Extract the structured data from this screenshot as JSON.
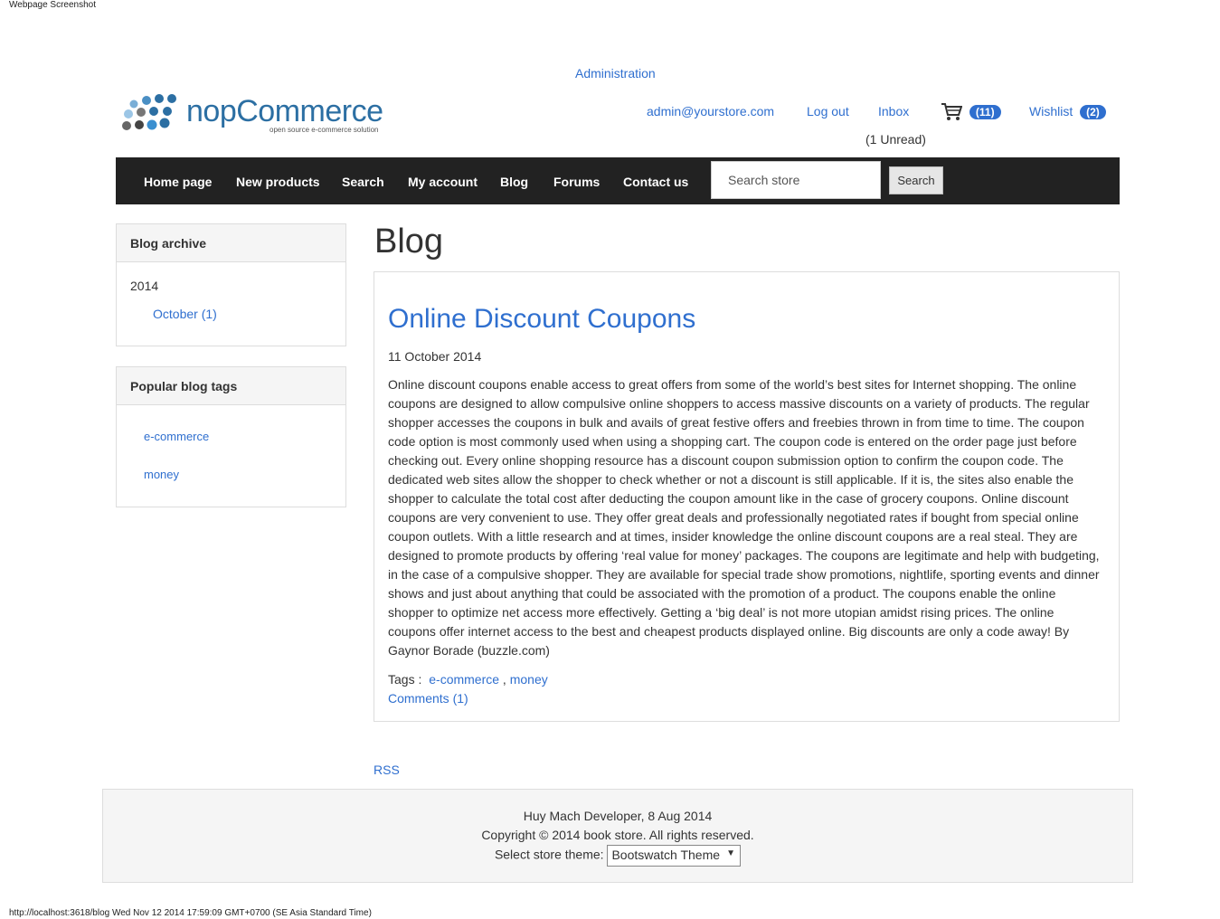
{
  "print": {
    "title": "Webpage Screenshot",
    "footer": "http://localhost:3618/blog Wed Nov 12 2014 17:59:09 GMT+0700 (SE Asia Standard Time)"
  },
  "header": {
    "admin_link": "Administration",
    "logo": {
      "name": "nopCommerce",
      "tagline": "open source e-commerce solution"
    },
    "account_email": "admin@yourstore.com",
    "logout": "Log out",
    "inbox": "Inbox",
    "unread": "(1 Unread)",
    "cart_count": "(11)",
    "wishlist": "Wishlist",
    "wishlist_count": "(2)"
  },
  "nav": {
    "items": [
      "Home page",
      "New products",
      "Search",
      "My account",
      "Blog",
      "Forums",
      "Contact us"
    ],
    "search_placeholder": "Search store",
    "search_button": "Search"
  },
  "sidebar": {
    "archive": {
      "title": "Blog archive",
      "year": "2014",
      "month": "October (1)"
    },
    "tags": {
      "title": "Popular blog tags",
      "items": [
        "e-commerce",
        "money"
      ]
    }
  },
  "main": {
    "page_title": "Blog",
    "post": {
      "title": "Online Discount Coupons",
      "date": "11 October 2014",
      "body": "Online discount coupons enable access to great offers from some of the world’s best sites for Internet shopping. The online coupons are designed to allow compulsive online shoppers to access massive discounts on a variety of products. The regular shopper accesses the coupons in bulk and avails of great festive offers and freebies thrown in from time to time. The coupon code option is most commonly used when using a shopping cart. The coupon code is entered on the order page just before checking out. Every online shopping resource has a discount coupon submission option to confirm the coupon code. The dedicated web sites allow the shopper to check whether or not a discount is still applicable. If it is, the sites also enable the shopper to calculate the total cost after deducting the coupon amount like in the case of grocery coupons. Online discount coupons are very convenient to use. They offer great deals and professionally negotiated rates if bought from special online coupon outlets. With a little research and at times, insider knowledge the online discount coupons are a real steal. They are designed to promote products by offering ‘real value for money’ packages. The coupons are legitimate and help with budgeting, in the case of a compulsive shopper. They are available for special trade show promotions, nightlife, sporting events and dinner shows and just about anything that could be associated with the promotion of a product. The coupons enable the online shopper to optimize net access more effectively. Getting a ‘big deal’ is not more utopian amidst rising prices. The online coupons offer internet access to the best and cheapest products displayed online. Big discounts are only a code away! By Gaynor Borade (buzzle.com)",
      "tags_label": "Tags :",
      "tags": [
        "e-commerce",
        "money"
      ],
      "comments": "Comments (1)"
    },
    "rss": "RSS"
  },
  "footer": {
    "powered": "Huy Mach Developer, 8 Aug 2014",
    "copyright": "Copyright © 2014 book store. All rights reserved.",
    "theme_label": "Select store theme:",
    "theme_value": "Bootswatch Theme"
  },
  "colors": {
    "link": "#2f6fcf",
    "navbar": "#222222",
    "badge": "#2f6fcf"
  }
}
